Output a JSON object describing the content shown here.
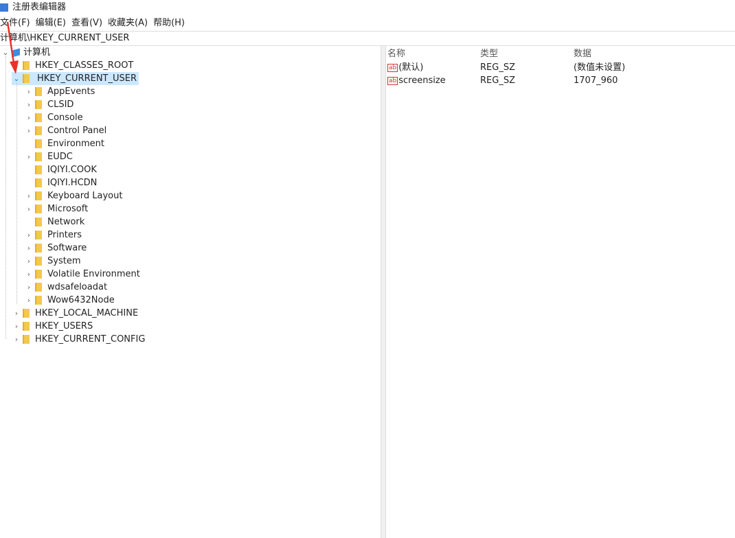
{
  "window": {
    "title": "注册表编辑器"
  },
  "menu": [
    "文件(F)",
    "编辑(E)",
    "查看(V)",
    "收藏夹(A)",
    "帮助(H)"
  ],
  "address": "计算机\\HKEY_CURRENT_USER",
  "tree": {
    "root": "计算机",
    "hives": [
      {
        "label": "HKEY_CLASSES_ROOT",
        "expanded": false
      },
      {
        "label": "HKEY_CURRENT_USER",
        "expanded": true,
        "selected": true,
        "children": [
          {
            "label": "AppEvents",
            "has_children": true
          },
          {
            "label": "CLSID",
            "has_children": true
          },
          {
            "label": "Console",
            "has_children": true
          },
          {
            "label": "Control Panel",
            "has_children": true
          },
          {
            "label": "Environment",
            "has_children": false
          },
          {
            "label": "EUDC",
            "has_children": true
          },
          {
            "label": "IQIYI.COOK",
            "has_children": false
          },
          {
            "label": "IQIYI.HCDN",
            "has_children": false
          },
          {
            "label": "Keyboard Layout",
            "has_children": true
          },
          {
            "label": "Microsoft",
            "has_children": true
          },
          {
            "label": "Network",
            "has_children": false
          },
          {
            "label": "Printers",
            "has_children": true
          },
          {
            "label": "Software",
            "has_children": true
          },
          {
            "label": "System",
            "has_children": true
          },
          {
            "label": "Volatile Environment",
            "has_children": true
          },
          {
            "label": "wdsafeloadat",
            "has_children": true
          },
          {
            "label": "Wow6432Node",
            "has_children": true
          }
        ]
      },
      {
        "label": "HKEY_LOCAL_MACHINE",
        "expanded": false
      },
      {
        "label": "HKEY_USERS",
        "expanded": false
      },
      {
        "label": "HKEY_CURRENT_CONFIG",
        "expanded": false
      }
    ]
  },
  "values": {
    "headers": {
      "name": "名称",
      "type": "类型",
      "data": "数据"
    },
    "rows": [
      {
        "name": "(默认)",
        "type": "REG_SZ",
        "data": "(数值未设置)"
      },
      {
        "name": "screensize",
        "type": "REG_SZ",
        "data": "1707_960"
      }
    ]
  },
  "colors": {
    "selection": "#cce8ff",
    "annotation_arrow": "#e8322a"
  }
}
